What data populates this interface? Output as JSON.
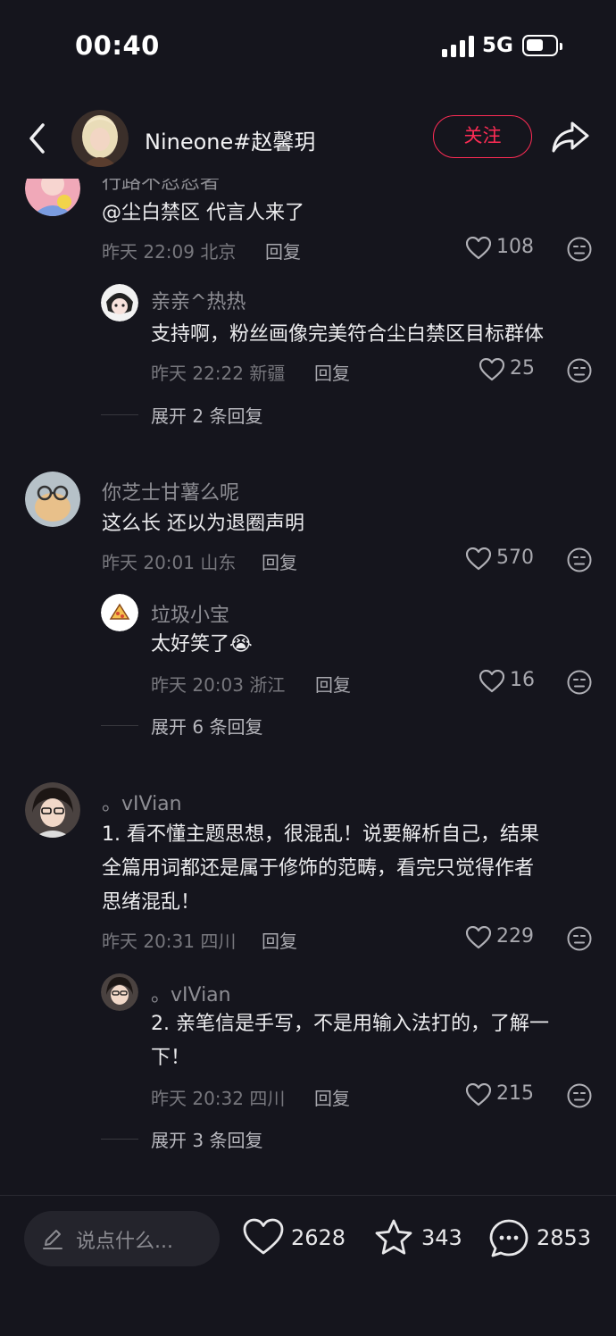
{
  "status_bar": {
    "time": "00:40",
    "network": "5G",
    "battery_level": 0.6
  },
  "header": {
    "back_icon": "chevron-left-icon",
    "username": "Nineone#赵馨玥",
    "follow_label": "关注",
    "share_icon": "share-arrow-icon",
    "accent_color": "#fe2c55"
  },
  "comments": [
    {
      "nick": "行路不忍忍者",
      "text": "@尘白禁区 代言人来了",
      "time": "昨天 22:09",
      "location": "北京",
      "reply_label": "回复",
      "likes": "108",
      "replies": [
        {
          "nick": "亲亲^热热",
          "text": "支持啊，粉丝画像完美符合尘白禁区目标群体",
          "time": "昨天 22:22",
          "location": "新疆",
          "reply_label": "回复",
          "likes": "25"
        }
      ],
      "expand_label": "展开 2 条回复"
    },
    {
      "nick": "你芝士甘薯么呢",
      "text": "这么长 还以为退圈声明",
      "time": "昨天 20:01",
      "location": "山东",
      "reply_label": "回复",
      "likes": "570",
      "replies": [
        {
          "nick": "垃圾小宝",
          "text": "太好笑了",
          "emoji": "😭",
          "time": "昨天 20:03",
          "location": "浙江",
          "reply_label": "回复",
          "likes": "16"
        }
      ],
      "expand_label": "展开 6 条回复"
    },
    {
      "nick": "。vIVian",
      "text_lines": [
        "1. 看不懂主题思想，很混乱！说要解析自己，结果",
        "全篇用词都还是属于修饰的范畴，看完只觉得作者",
        "思绪混乱！"
      ],
      "time": "昨天 20:31",
      "location": "四川",
      "reply_label": "回复",
      "likes": "229",
      "replies": [
        {
          "nick": "。vIVian",
          "text_lines": [
            "2. 亲笔信是手写，不是用输入法打的，了解一",
            "下！"
          ],
          "time": "昨天 20:32",
          "location": "四川",
          "reply_label": "回复",
          "likes": "215"
        }
      ],
      "expand_label": "展开 3 条回复"
    }
  ],
  "bottom_bar": {
    "input_placeholder": "说点什么...",
    "like_count": "2628",
    "favorite_count": "343",
    "comment_count": "2853"
  }
}
